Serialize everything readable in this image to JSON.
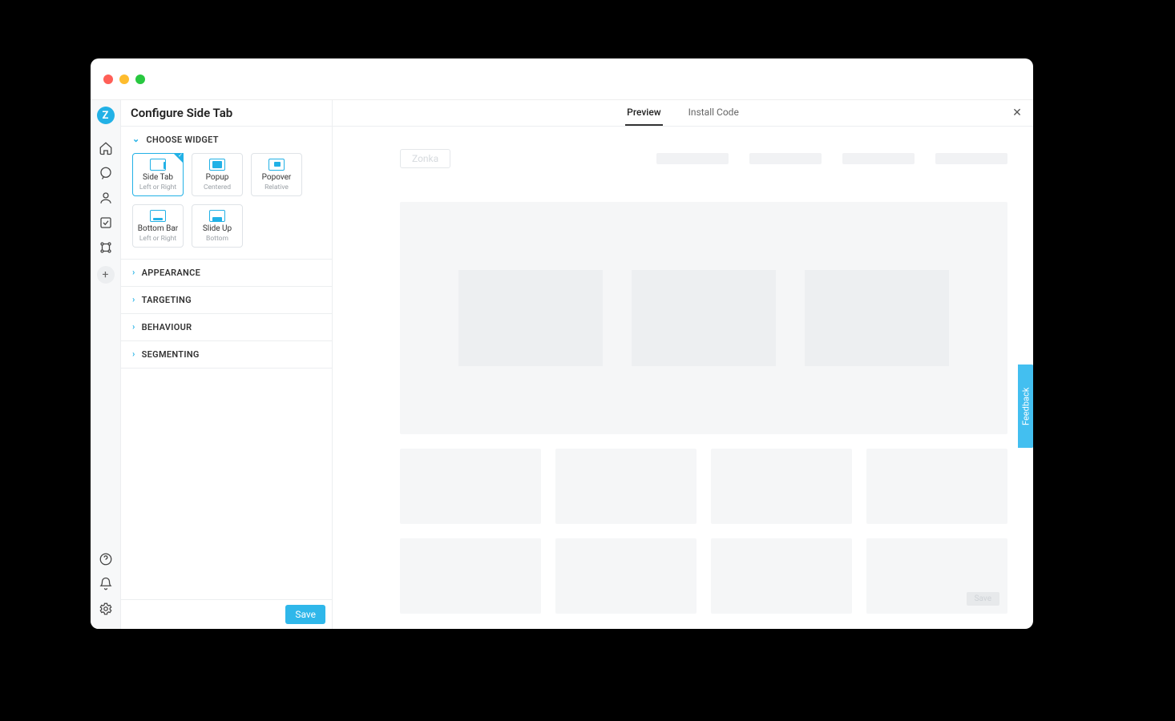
{
  "header": {
    "title": "Configure Side Tab"
  },
  "nav": {
    "logo_letter": "Z"
  },
  "panel": {
    "sections": {
      "choose_widget": "CHOOSE WIDGET",
      "appearance": "APPEARANCE",
      "targeting": "TARGETING",
      "behaviour": "BEHAVIOUR",
      "segmenting": "SEGMENTING"
    },
    "widgets": [
      {
        "key": "sidetab",
        "label": "Side Tab",
        "sub": "Left or Right",
        "selected": true
      },
      {
        "key": "popup",
        "label": "Popup",
        "sub": "Centered",
        "selected": false
      },
      {
        "key": "popover",
        "label": "Popover",
        "sub": "Relative",
        "selected": false
      },
      {
        "key": "bottombar",
        "label": "Bottom Bar",
        "sub": "Left or Right",
        "selected": false
      },
      {
        "key": "slideup",
        "label": "Slide Up",
        "sub": "Bottom",
        "selected": false
      }
    ],
    "save_label": "Save"
  },
  "tabs": {
    "preview": "Preview",
    "install_code": "Install Code"
  },
  "preview": {
    "logo_text": "Zonka",
    "inner_save": "Save"
  },
  "feedback_tab": "Feedback",
  "colors": {
    "accent": "#22b1e6"
  }
}
